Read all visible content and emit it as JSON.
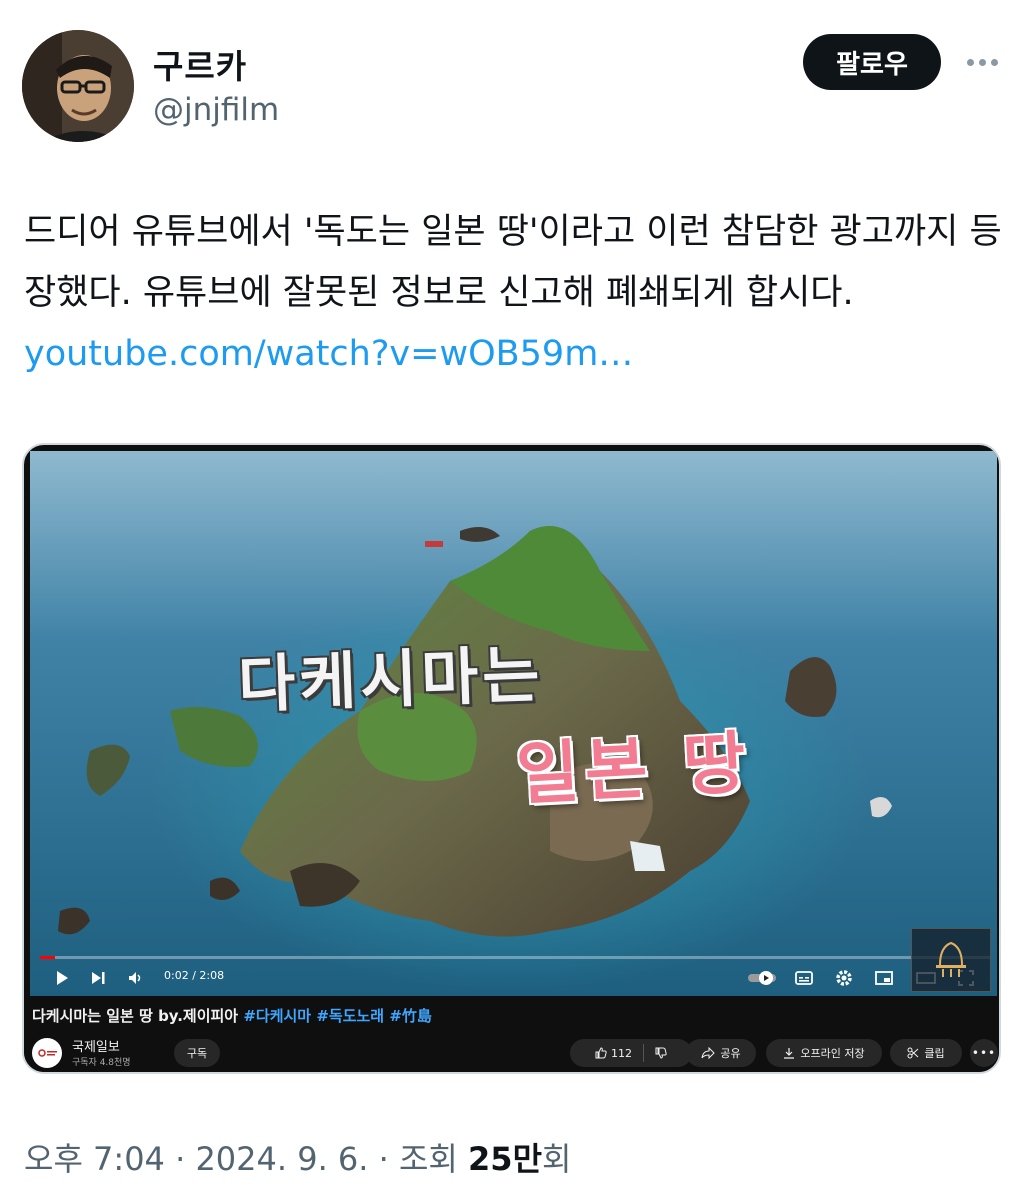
{
  "author": {
    "display_name": "구르카",
    "handle": "@jnjfilm"
  },
  "follow_label": "팔로우",
  "tweet": {
    "text": "드디어 유튜브에서 '독도는 일본 땅'이라고 이런 참담한 광고까지 등장했다. 유튜브에 잘못된 정보로 신고해 폐쇄되게 합시다. ",
    "link": "youtube.com/watch?v=wOB59m…"
  },
  "video": {
    "overlay_line1": "다케시마는",
    "overlay_line2": "일본 땅",
    "time": "0:02 / 2:08",
    "progress": 0.016,
    "title": "다케시마는 일본 땅 by.제이피아",
    "hashtags": "#다케시마 #독도노래 #竹島",
    "channel_name": "국제일보",
    "subscribers": "구독자 4.8천명",
    "subscribe_label": "구독",
    "like_count": "112",
    "share_label": "공유",
    "offline_label": "오프라인 저장",
    "clip_label": "클립"
  },
  "footer": {
    "time": "오후 7:04",
    "sep1": " · ",
    "date": "2024. 9. 6.",
    "sep2": " · ",
    "views_prefix": "조회 ",
    "views": "25만",
    "views_suffix": "회"
  },
  "colors": {
    "link": "#1d9bf0",
    "follow_bg": "#0f1419",
    "overlay_pink": "#f27d92",
    "progress_red": "#ff0000"
  }
}
